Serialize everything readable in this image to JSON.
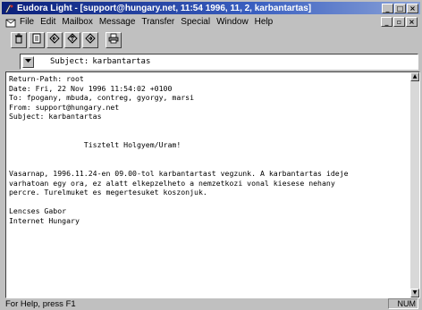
{
  "window": {
    "title": "Eudora Light - [support@hungary.net, 11:54 1996, 11, 2, karbantartas]",
    "controls": {
      "minimize": "_",
      "maximize": "□",
      "close": "×"
    }
  },
  "menu": {
    "items": [
      "File",
      "Edit",
      "Mailbox",
      "Message",
      "Transfer",
      "Special",
      "Window",
      "Help"
    ],
    "doc_controls": {
      "minimize": "_",
      "restore": "▫",
      "close": "×"
    }
  },
  "toolbar": {
    "buttons": [
      "trash-icon",
      "new-message-icon",
      "reply-icon",
      "forward-icon",
      "redirect-icon",
      "print-icon"
    ]
  },
  "subject_bar": {
    "label": "Subject:",
    "value": "karbantartas"
  },
  "message": {
    "body": "Return-Path: root\nDate: Fri, 22 Nov 1996 11:54:02 +0100\nTo: fpogany, mbuda, contreg, gyorgy, marsi\nFrom: support@hungary.net\nSubject: karbantartas\n\n\n                 Tisztelt Holgyem/Uram!\n\n\nVasarnap, 1996.11.24-en 09.00-tol karbantartast vegzunk. A karbantartas ideje\nvarhatoan egy ora, ez alatt elkepzelheto a nemzetkozi vonal kiesese nehany\npercre. Turelmuket es megertesuket koszonjuk.\n\nLencses Gabor\nInternet Hungary"
  },
  "status": {
    "help_text": "For Help, press F1",
    "indicator": "NUM"
  }
}
